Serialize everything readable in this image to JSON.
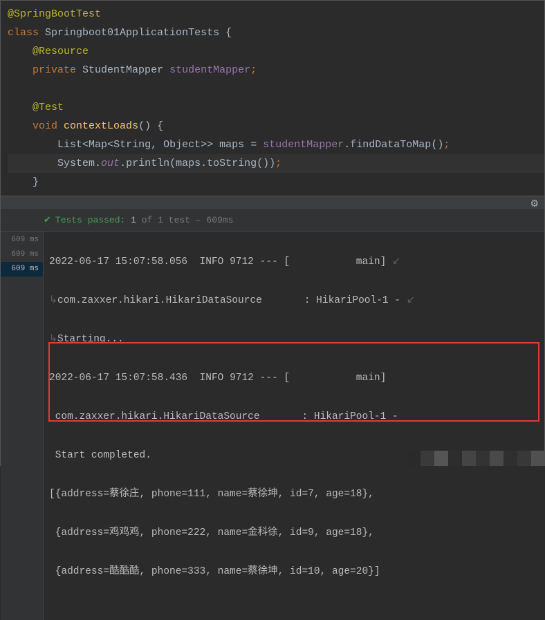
{
  "code": {
    "annotation1": "@SpringBootTest",
    "class_kw": "class",
    "class_name": "Springboot01ApplicationTests",
    "annotation2": "@Resource",
    "private_kw": "private",
    "field_type": "StudentMapper",
    "field_name": "studentMapper",
    "annotation3": "@Test",
    "void_kw": "void",
    "method_name": "contextLoads",
    "list_type": "List",
    "map_type": "Map",
    "string_type": "String",
    "object_type": "Object",
    "maps_var": "maps",
    "student_mapper_ref": "studentMapper",
    "find_method": "findDataToMap",
    "system": "System",
    "out": "out",
    "println": "println",
    "maps_ref": "maps",
    "tostring": "toString"
  },
  "test_bar": {
    "prefix": "Tests passed:",
    "count": "1",
    "of_text": "of 1 test",
    "duration": "– 609ms"
  },
  "timings": {
    "t1": "609 ms",
    "t2": "609 ms",
    "t3": "609 ms"
  },
  "console": {
    "line1_ts": "2022-06-17 15:07:58.056",
    "line1_level": "INFO",
    "line1_pid": "9712",
    "line1_sep": "---",
    "line1_thread": "[           main]",
    "line2_logger": "com.zaxxer.hikari.HikariDataSource",
    "line2_msg": ": HikariPool-1 -",
    "line3": "Starting...",
    "line4_ts": "2022-06-17 15:07:58.436",
    "line4_level": "INFO",
    "line4_pid": "9712",
    "line4_sep": "---",
    "line4_thread": "[           main]",
    "line5_logger": "com.zaxxer.hikari.HikariDataSource",
    "line5_msg": ": HikariPool-1 -",
    "line6": "Start completed.",
    "out1": "[{address=蔡徐庄, phone=111, name=蔡徐坤, id=7, age=18},",
    "out2": " {address=鸡鸡鸡, phone=222, name=金科徐, id=9, age=18},",
    "out3": " {address=酷酷酷, phone=333, name=蔡徐坤, id=10, age=20}]"
  },
  "chart_data": {
    "type": "table",
    "title": "studentMapper.findDataToMap() output",
    "columns": [
      "address",
      "phone",
      "name",
      "id",
      "age"
    ],
    "rows": [
      {
        "address": "蔡徐庄",
        "phone": 111,
        "name": "蔡徐坤",
        "id": 7,
        "age": 18
      },
      {
        "address": "鸡鸡鸡",
        "phone": 222,
        "name": "金科徐",
        "id": 9,
        "age": 18
      },
      {
        "address": "酷酷酷",
        "phone": 333,
        "name": "蔡徐坤",
        "id": 10,
        "age": 20
      }
    ]
  }
}
